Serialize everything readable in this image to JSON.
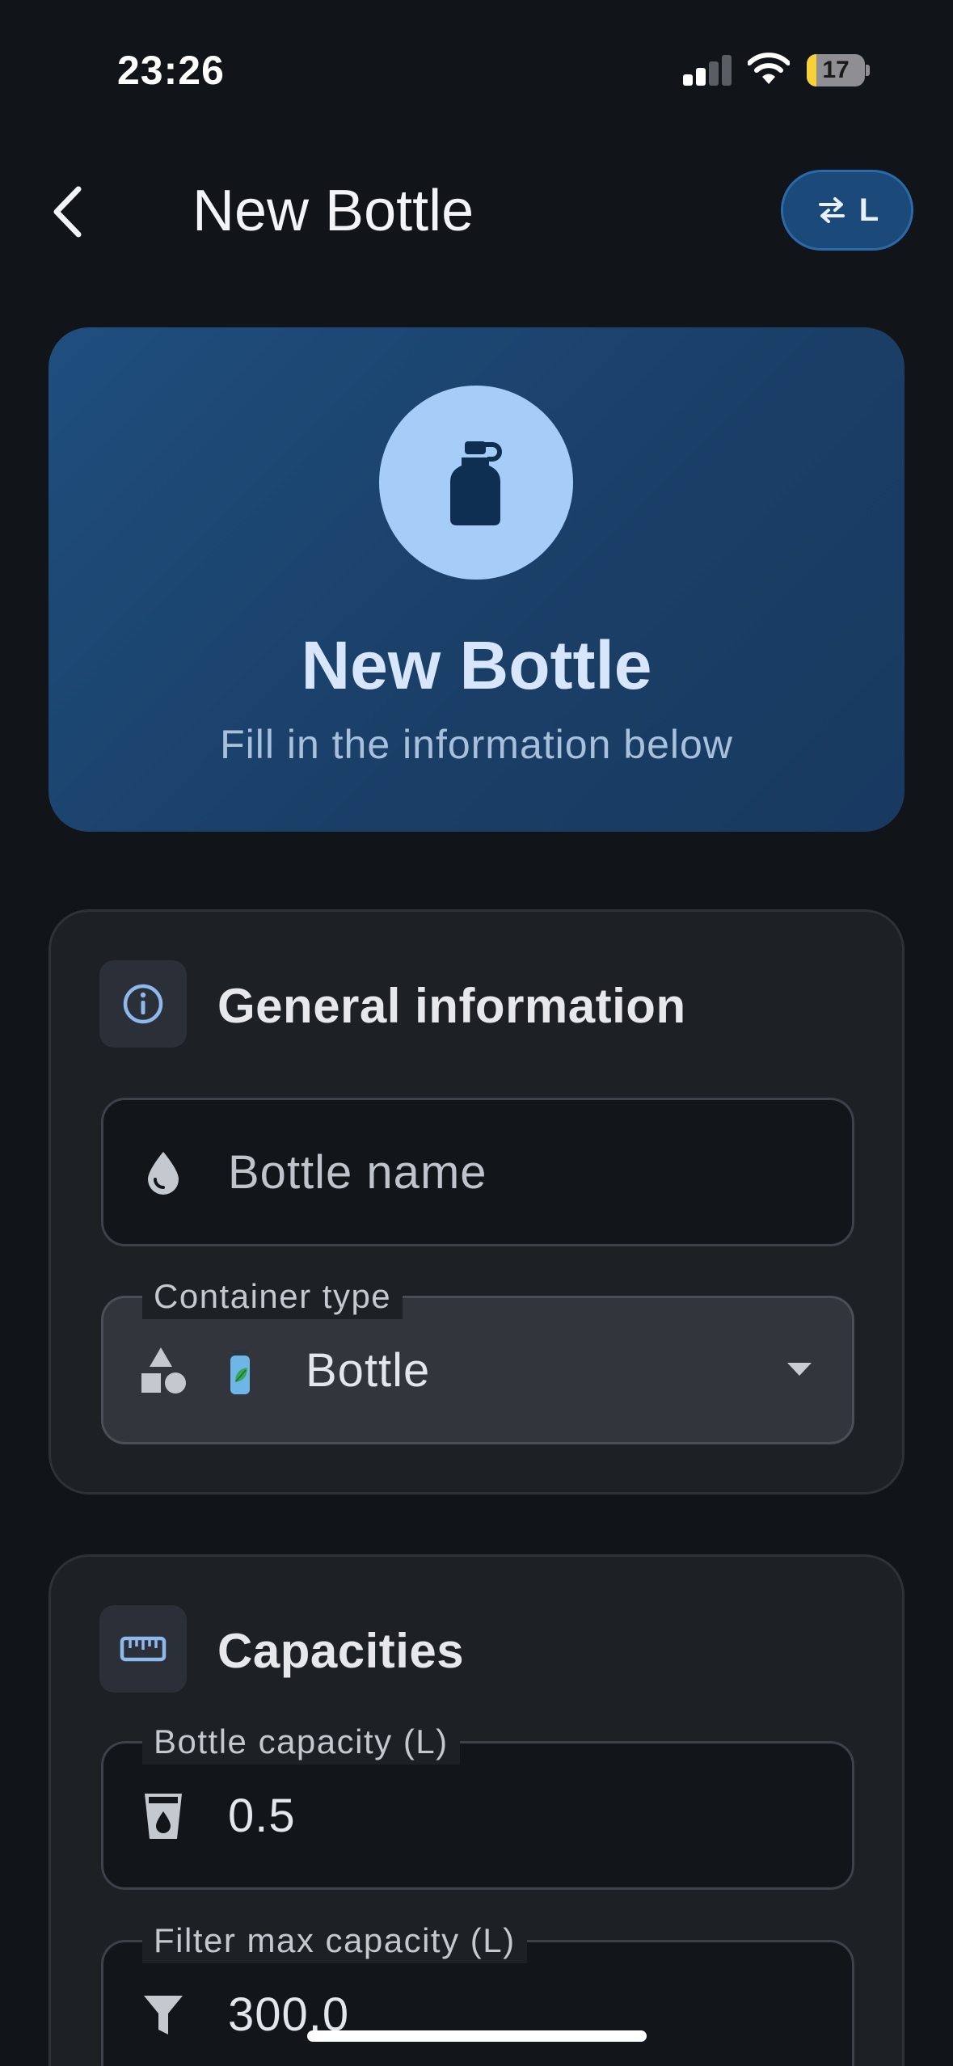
{
  "status_bar": {
    "time": "23:26",
    "battery_level": "17",
    "battery_fraction": 0.17,
    "signal_bars_active": 2,
    "signal_bars_total": 4,
    "battery_color": "#f6d13a"
  },
  "app_bar": {
    "title": "New Bottle",
    "back_icon": "chevron-left-icon",
    "unit_toggle": {
      "icon": "swap-arrows-icon",
      "label": "L"
    }
  },
  "hero": {
    "icon": "water-bottle-icon",
    "title": "New Bottle",
    "subtitle": "Fill in the information below"
  },
  "general_section": {
    "icon": "info-icon",
    "title": "General information",
    "name_field": {
      "icon": "water-drop-icon",
      "placeholder": "Bottle name",
      "value": ""
    },
    "container_type": {
      "label": "Container type",
      "icon": "shapes-icon",
      "option_icon": "eco-bottle-icon",
      "selected": "Bottle"
    }
  },
  "capacities_section": {
    "icon": "ruler-icon",
    "title": "Capacities",
    "bottle_capacity": {
      "label": "Bottle capacity (L)",
      "icon": "cup-drop-icon",
      "value": "0.5"
    },
    "filter_capacity": {
      "label": "Filter max capacity (L)",
      "icon": "filter-icon",
      "value": "300.0"
    }
  },
  "colors": {
    "background": "#111418",
    "accent": "#a6cdf8",
    "hero_start": "#1f4e7e",
    "card": "#1d2025"
  }
}
